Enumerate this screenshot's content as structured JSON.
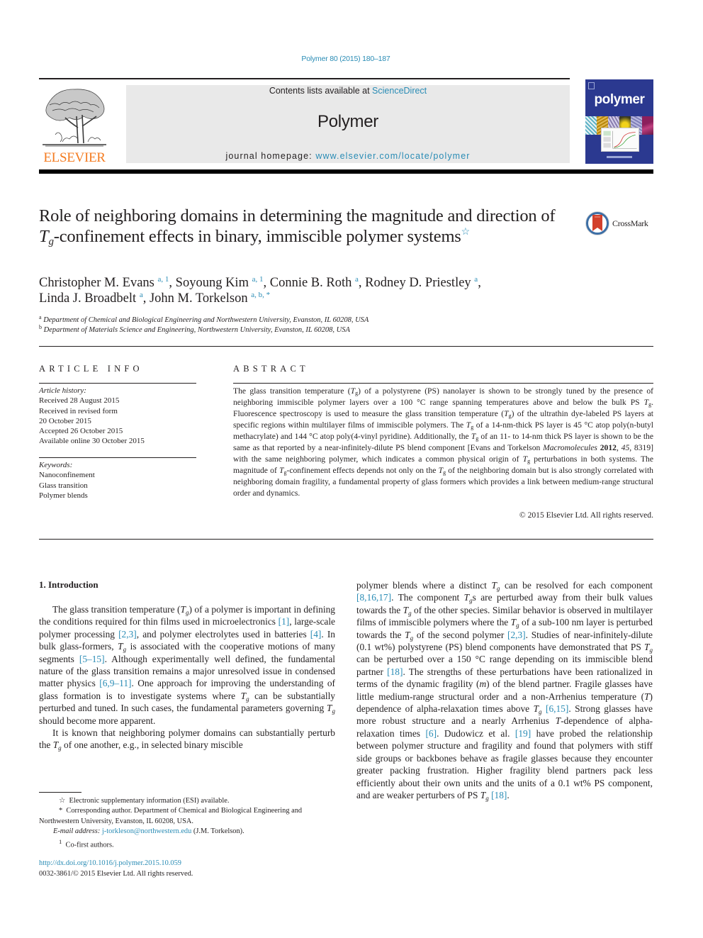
{
  "header": {
    "citation": "Polymer 80 (2015) 180–187",
    "contents_prefix": "Contents lists available at ",
    "contents_link": "ScienceDirect",
    "journal_name": "Polymer",
    "homepage_prefix": "journal homepage: ",
    "homepage_link": "www.elsevier.com/locate/polymer",
    "publisher_logo_text": "ELSEVIER",
    "cover_title": "polymer",
    "crossmark_label": "CrossMark",
    "colors": {
      "link": "#2a8cb5",
      "elsevier_orange": "#f47b20",
      "cover_blue": "#2b3990"
    }
  },
  "article": {
    "title_part1": "Role of neighboring domains in determining the magnitude and direction of ",
    "title_T": "T",
    "title_g": "g",
    "title_part2": "-confinement effects in binary, immiscible polymer systems",
    "title_mark": "☆",
    "authors": [
      {
        "name": "Christopher M. Evans",
        "sup": "a, 1",
        "sep": ", "
      },
      {
        "name": "Soyoung Kim",
        "sup": "a, 1",
        "sep": ", "
      },
      {
        "name": "Connie B. Roth",
        "sup": "a",
        "sep": ", "
      },
      {
        "name": "Rodney D. Priestley",
        "sup": "a",
        "sep": ","
      },
      {
        "name": "Linda J. Broadbelt",
        "sup": "a",
        "sep": ", "
      },
      {
        "name": "John M. Torkelson",
        "sup": "a, b, *",
        "sep": ""
      }
    ],
    "affiliations": [
      {
        "mark": "a",
        "text": "Department of Chemical and Biological Engineering and Northwestern University, Evanston, IL 60208, USA"
      },
      {
        "mark": "b",
        "text": "Department of Materials Science and Engineering, Northwestern University, Evanston, IL 60208, USA"
      }
    ]
  },
  "article_info": {
    "heading": "ARTICLE INFO",
    "history_label": "Article history:",
    "history": [
      "Received 28 August 2015",
      "Received in revised form",
      "20 October 2015",
      "Accepted 26 October 2015",
      "Available online 30 October 2015"
    ],
    "keywords_label": "Keywords:",
    "keywords": [
      "Nanoconfinement",
      "Glass transition",
      "Polymer blends"
    ]
  },
  "abstract": {
    "heading": "ABSTRACT",
    "s1a": "The glass transition temperature (",
    "s1b": ") of a polystyrene (PS) nanolayer is shown to be strongly tuned by the presence of neighboring immiscible polymer layers over a 100 °C range spanning temperatures above and below the bulk PS ",
    "s1c": ". Fluorescence spectroscopy is used to measure the glass transition temperature (",
    "s1d": ") of the ultrathin dye-labeled PS layers at specific regions within multilayer films of immiscible polymers. The ",
    "s1e": " of a 14-nm-thick PS layer is 45 °C atop poly(n-butyl methacrylate) and 144 °C atop poly(4-vinyl pyridine). Additionally, the ",
    "s1f": " of an 11- to 14-nm thick PS layer is shown to be the same as that reported by a near-infinitely-dilute PS blend component [Evans and Torkelson ",
    "journal_ital": "Macromolecules",
    "year_bold": "2012",
    "vol_ital": "45",
    "s1g": ", 8319] with the same neighboring polymer, which indicates a common physical origin of ",
    "s1h": " perturbations in both systems. The magnitude of ",
    "s1i": "-confinement effects depends not only on the ",
    "s1j": " of the neighboring domain but is also strongly correlated with neighboring domain fragility, a fundamental property of glass formers which provides a link between medium-range structural order and dynamics.",
    "copyright": "© 2015 Elsevier Ltd. All rights reserved.",
    "T": "T",
    "g": "g"
  },
  "introduction": {
    "heading": "1.  Introduction",
    "T": "T",
    "g": "g",
    "p1": [
      "The glass transition temperature (",
      ") of a polymer is important in defining the conditions required for thin films used in microelectronics ",
      ", large-scale polymer processing ",
      ", and polymer electrolytes used in batteries ",
      ". In bulk glass-formers, ",
      " is associated with the cooperative motions of many segments ",
      ". Although experimentally well defined, the fundamental nature of the glass transition remains a major unresolved issue in condensed matter physics ",
      ". One approach for improving the understanding of glass formation is to investigate systems where ",
      " can be substantially perturbed and tuned. In such cases, the fundamental parameters governing ",
      " should become more apparent."
    ],
    "p1_refs": [
      "[1]",
      "[2,3]",
      "[4]",
      "[5–15]",
      "[6,9–11]"
    ],
    "p2": [
      "It is known that neighboring polymer domains can substantially perturb the ",
      " of one another, e.g., in selected binary miscible polymer blends where a distinct ",
      " can be resolved for each component ",
      ". The component ",
      "s are perturbed away from their bulk values towards the ",
      " of the other species. Similar behavior is observed in multilayer films of immiscible polymers where the ",
      " of a sub-100 nm layer is perturbed towards the ",
      " of the second polymer ",
      ". Studies of near-infinitely-dilute (0.1 wt%) polystyrene (PS) blend components have demonstrated that PS ",
      " can be perturbed over a 150 °C range depending on its immiscible blend partner ",
      ". The strengths of these perturbations have been rationalized in terms of the dynamic fragility (",
      "m",
      ") of the blend partner. Fragile glasses have little medium-range structural order and a non-Arrhenius temperature (",
      "T",
      ") dependence of alpha-relaxation times above ",
      " ",
      ". Strong glasses have more robust structure and a nearly Arrhenius ",
      "T",
      "-dependence of alpha-relaxation times ",
      ". Dudowicz et al. ",
      " have probed the relationship between polymer structure and fragility and found that polymers with stiff side groups or backbones behave as fragile glasses because they encounter greater packing frustration. Higher fragility blend partners pack less efficiently about their own units and the units of a 0.1 wt% PS component, and are weaker perturbers of PS ",
      " ",
      "."
    ],
    "p2_refs": [
      "[8,16,17]",
      "[2,3]",
      "[18]",
      "[6,15]",
      "[6]",
      "[19]",
      "[18]"
    ]
  },
  "footnotes": {
    "star_mark": "☆",
    "star_text": "Electronic supplementary information (ESI) available.",
    "corr_mark": "*",
    "corr_text": "Corresponding author. Department of Chemical and Biological Engineering and Northwestern University, Evanston, IL 60208, USA.",
    "email_label": "E-mail address: ",
    "email": "j-torkleson@northwestern.edu",
    "email_suffix": " (J.M. Torkelson).",
    "cofirst_mark": "1",
    "cofirst_text": "Co-first authors.",
    "doi": "http://dx.doi.org/10.1016/j.polymer.2015.10.059",
    "issn_line": "0032-3861/© 2015 Elsevier Ltd. All rights reserved."
  }
}
